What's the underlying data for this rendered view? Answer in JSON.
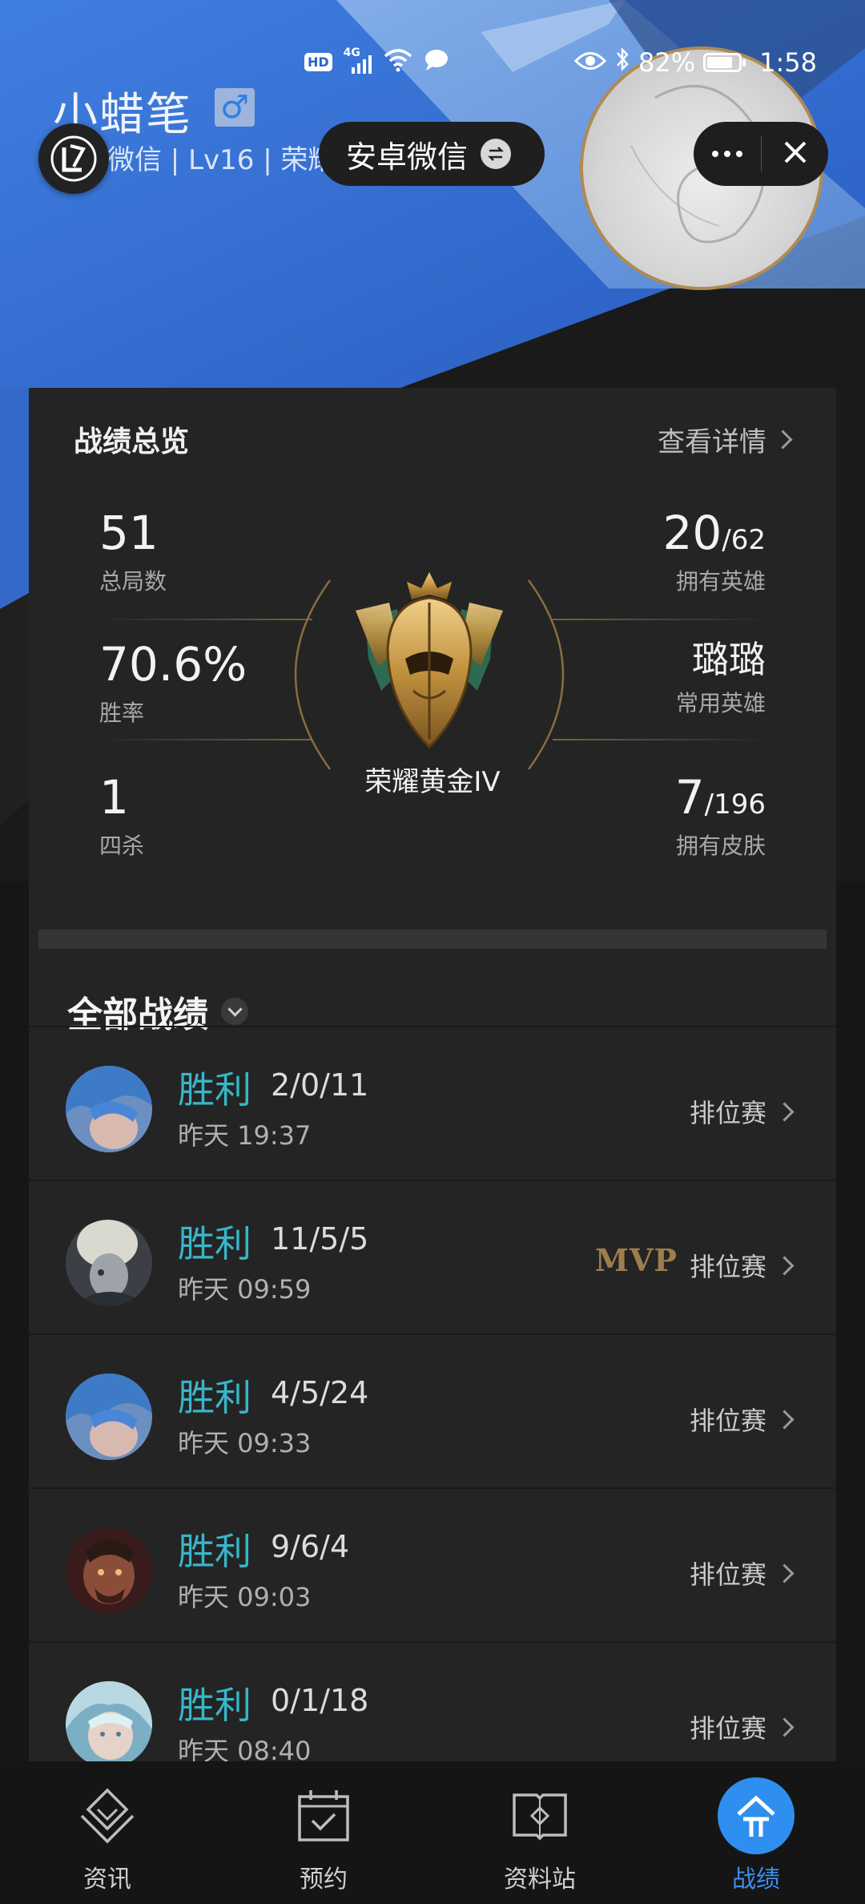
{
  "status_bar": {
    "hd": "HD",
    "network": "4G",
    "battery_text": "82%",
    "battery_level": 0.82,
    "time": "1:58"
  },
  "profile": {
    "name": "小蜡笔",
    "gender_symbol": "♂",
    "subtitle": "微信 | Lv16 | 荣耀黄金"
  },
  "switch_button": {
    "label": "安卓微信"
  },
  "overview": {
    "title": "战绩总览",
    "detail_link": "查看详情",
    "total_games": {
      "value": "51",
      "label": "总局数"
    },
    "win_rate": {
      "value": "70.6%",
      "label": "胜率"
    },
    "quadra_kills": {
      "value": "1",
      "label": "四杀"
    },
    "heroes_owned": {
      "value": "20",
      "total": "/62",
      "label": "拥有英雄"
    },
    "common_hero": {
      "value": "璐璐",
      "label": "常用英雄"
    },
    "skins_owned": {
      "value": "7",
      "total": "/196",
      "label": "拥有皮肤"
    },
    "rank": "荣耀黄金IV"
  },
  "all_matches": {
    "title": "全部战绩",
    "items": [
      {
        "result": "胜利",
        "kda": "2/0/11",
        "time": "昨天 19:37",
        "mode": "排位赛",
        "mvp": ""
      },
      {
        "result": "胜利",
        "kda": "11/5/5",
        "time": "昨天 09:59",
        "mode": "排位赛",
        "mvp": "MVP"
      },
      {
        "result": "胜利",
        "kda": "4/5/24",
        "time": "昨天 09:33",
        "mode": "排位赛",
        "mvp": ""
      },
      {
        "result": "胜利",
        "kda": "9/6/4",
        "time": "昨天 09:03",
        "mode": "排位赛",
        "mvp": ""
      },
      {
        "result": "胜利",
        "kda": "0/1/18",
        "time": "昨天 08:40",
        "mode": "排位赛",
        "mvp": ""
      }
    ]
  },
  "bottom_nav": [
    {
      "label": "资讯",
      "icon": "news-icon"
    },
    {
      "label": "预约",
      "icon": "calendar-icon"
    },
    {
      "label": "资料站",
      "icon": "book-icon"
    },
    {
      "label": "战绩",
      "icon": "record-icon",
      "active": true
    }
  ],
  "colors": {
    "accent_blue": "#3d8ef0",
    "win_cyan": "#38b6c8",
    "gold": "#b08a52",
    "card_bg": "#242424"
  }
}
